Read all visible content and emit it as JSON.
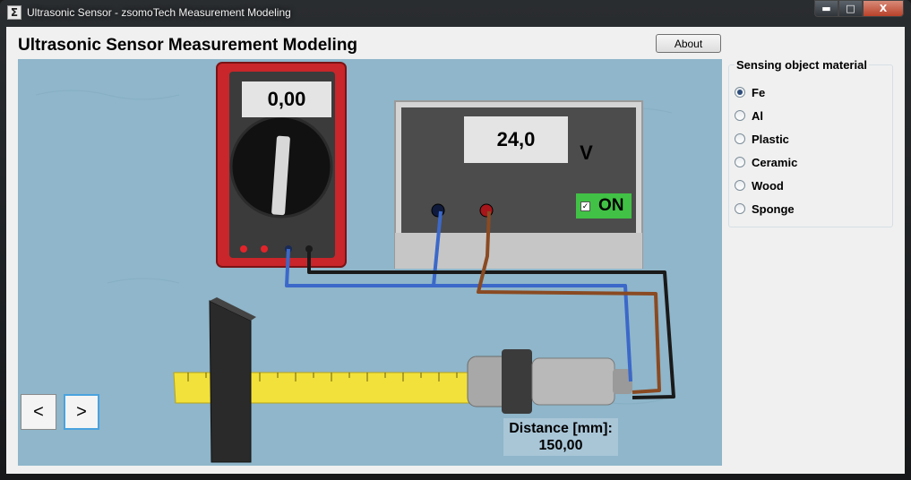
{
  "window": {
    "app_icon_glyph": "Σ",
    "title": "Ultrasonic Sensor - zsomoTech Measurement Modeling",
    "minimize_glyph": "▬",
    "maximize_glyph": "□",
    "close_glyph": "X"
  },
  "header": {
    "title": "Ultrasonic Sensor Measurement Modeling",
    "about_label": "About"
  },
  "scene": {
    "multimeter_reading": "0,00",
    "power_supply_reading": "24,0",
    "power_supply_unit": "V",
    "power_switch_label": "ON",
    "power_switch_checked": true,
    "distance_label": "Distance [mm]:",
    "distance_value": "150,00",
    "prev_label": "<",
    "next_label": ">"
  },
  "material_panel": {
    "title": "Sensing object material",
    "options": [
      {
        "label": "Fe",
        "selected": true
      },
      {
        "label": "Al",
        "selected": false
      },
      {
        "label": "Plastic",
        "selected": false
      },
      {
        "label": "Ceramic",
        "selected": false
      },
      {
        "label": "Wood",
        "selected": false
      },
      {
        "label": "Sponge",
        "selected": false
      }
    ]
  },
  "colors": {
    "scene_background": "#8fb6ca",
    "multimeter_body": "#c8262a",
    "power_on": "#41c145",
    "ruler": "#f2e13a",
    "wire_blue": "#3b68c9",
    "wire_brown": "#8a4a22",
    "wire_black": "#1a1a1a"
  }
}
